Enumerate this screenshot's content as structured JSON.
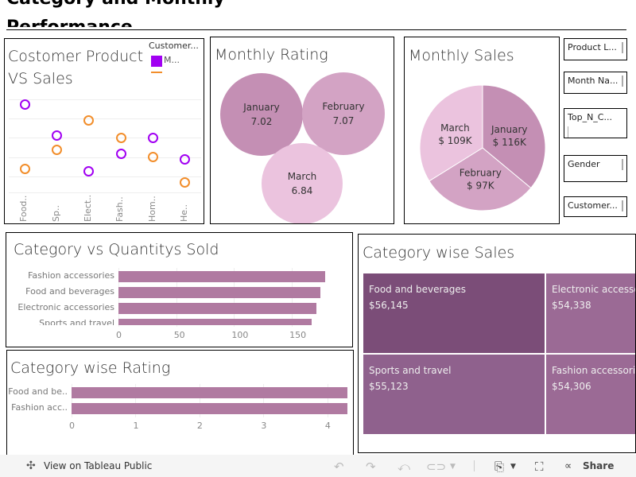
{
  "dashboard": {
    "title_line1": "Category and Monthly",
    "title_line2": "Performance"
  },
  "scatter": {
    "title": "Costomer Product VS Sales",
    "legend_title": "Customer...",
    "legend_items": [
      {
        "label": "M...",
        "color": "#a100f2"
      },
      {
        "label": "",
        "color": "#f28e2b"
      }
    ]
  },
  "rating": {
    "title": "Monthly Rating"
  },
  "pie": {
    "title": "Monthly Sales"
  },
  "filters": [
    "Product L...",
    "Month Na...",
    "Top_N_C...",
    "Gender",
    "Customer..."
  ],
  "qty": {
    "title": "Category vs Quantitys Sold"
  },
  "catrating": {
    "title": "Category wise Rating"
  },
  "treemap": {
    "title": "Category wise Sales"
  },
  "toolbar": {
    "view_label": "View on Tableau Public",
    "share_label": "Share"
  },
  "chart_data": [
    {
      "type": "scatter",
      "title": "Costomer Product VS Sales",
      "categories": [
        "Food..",
        "Sp..",
        "Elect..",
        "Fash..",
        "Hom..",
        "He.."
      ],
      "series": [
        {
          "name": "M...",
          "color": "#a100f2",
          "values": [
            4.5,
            2.9,
            1.1,
            2.0,
            2.8,
            1.7
          ]
        },
        {
          "color": "#f28e2b",
          "values": [
            1.2,
            2.2,
            3.7,
            2.8,
            1.8,
            0.5
          ]
        }
      ],
      "grid": true
    },
    {
      "type": "bubble",
      "title": "Monthly Rating",
      "categories": [
        "January",
        "February",
        "March"
      ],
      "values": [
        7.02,
        7.07,
        6.84
      ],
      "labels": [
        "7.02",
        "7.07",
        "6.84"
      ],
      "colors": [
        "#c48fb4",
        "#d3a3c4",
        "#ebc3de"
      ]
    },
    {
      "type": "pie",
      "title": "Monthly Sales",
      "categories": [
        "January",
        "February",
        "March"
      ],
      "values": [
        116,
        97,
        109
      ],
      "labels": [
        "$ 116K",
        "$ 97K",
        "$ 109K"
      ],
      "colors": [
        "#c48fb4",
        "#d3a3c4",
        "#ebc3de"
      ]
    },
    {
      "type": "bar",
      "title": "Category vs Quantitys Sold",
      "categories": [
        "Fashion accessories",
        "Food and beverages",
        "Electronic accessories",
        "Sports and travel"
      ],
      "values": [
        179,
        175,
        171,
        167
      ],
      "xticks": [
        "0",
        "50",
        "100",
        "150"
      ],
      "xlim": [
        0,
        185
      ],
      "color": "#b07aa1"
    },
    {
      "type": "bar",
      "title": "Category wise Rating",
      "categories": [
        "Food and be..",
        "Fashion acc.."
      ],
      "values": [
        4.31,
        4.31
      ],
      "xticks": [
        "0",
        "1",
        "2",
        "3",
        "4"
      ],
      "xlim": [
        0,
        4.3
      ],
      "color": "#b07aa1"
    },
    {
      "type": "treemap",
      "title": "Category wise Sales",
      "categories": [
        "Food and beverages",
        "Sports and travel",
        "Electronic accesso",
        "Fashion accessorie"
      ],
      "values": [
        56145,
        55123,
        54338,
        54306
      ],
      "labels": [
        "$56,145",
        "$55,123",
        "$54,338",
        "$54,306"
      ],
      "colors": [
        "#7b4d78",
        "#8f618d",
        "#9b6a95",
        "#9b6a95"
      ]
    }
  ]
}
